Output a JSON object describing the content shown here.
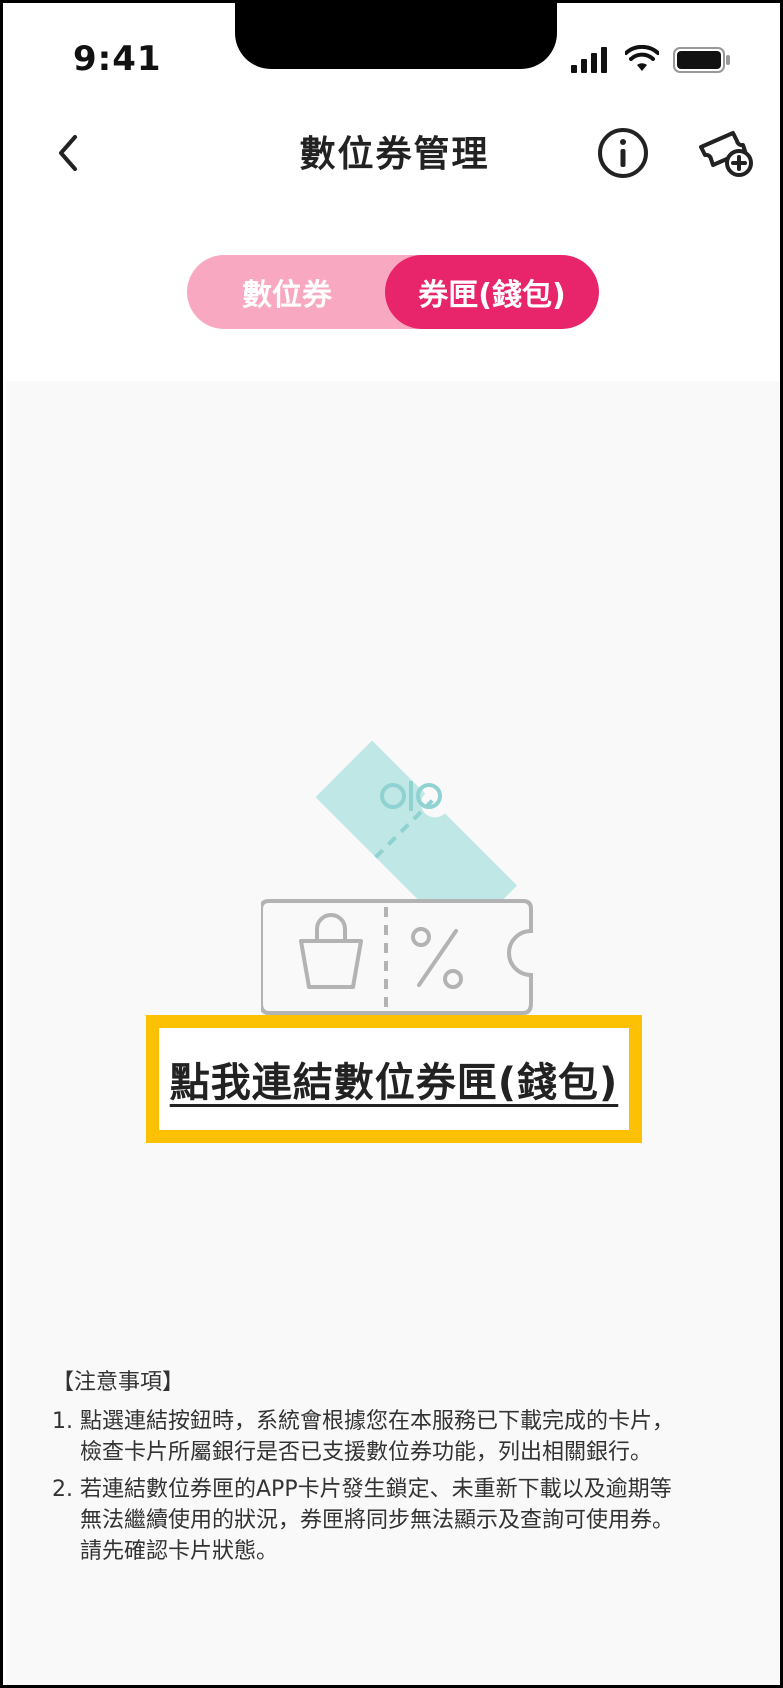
{
  "status_bar": {
    "time": "9:41"
  },
  "nav": {
    "title": "數位券管理",
    "back_icon": "chevron-left-icon",
    "info_icon": "info-circle-icon",
    "add_icon": "ticket-add-icon"
  },
  "tabs": [
    {
      "label": "數位券",
      "selected": false
    },
    {
      "label": "券匣(錢包)",
      "selected": true
    }
  ],
  "main": {
    "link_label": "點我連結數位券匣(錢包)"
  },
  "notes": {
    "title": "【注意事項】",
    "items": [
      {
        "num": "1.",
        "text": "點選連結按鈕時，系統會根據您在本服務已下載完成的卡片，\n檢查卡片所屬銀行是否已支援數位券功能，列出相關銀行。"
      },
      {
        "num": "2.",
        "text": "若連結數位券匣的APP卡片發生鎖定、未重新下載以及逾期等\n無法繼續使用的狀況，券匣將同步無法顯示及查詢可使用券。\n請先確認卡片狀態。"
      }
    ]
  },
  "colors": {
    "accent": "#e8246a",
    "accent_light": "#f8a9c1",
    "highlight_border": "#fcc102",
    "teal": "#bfe7e6",
    "grey_outline": "#b3b3b3"
  }
}
